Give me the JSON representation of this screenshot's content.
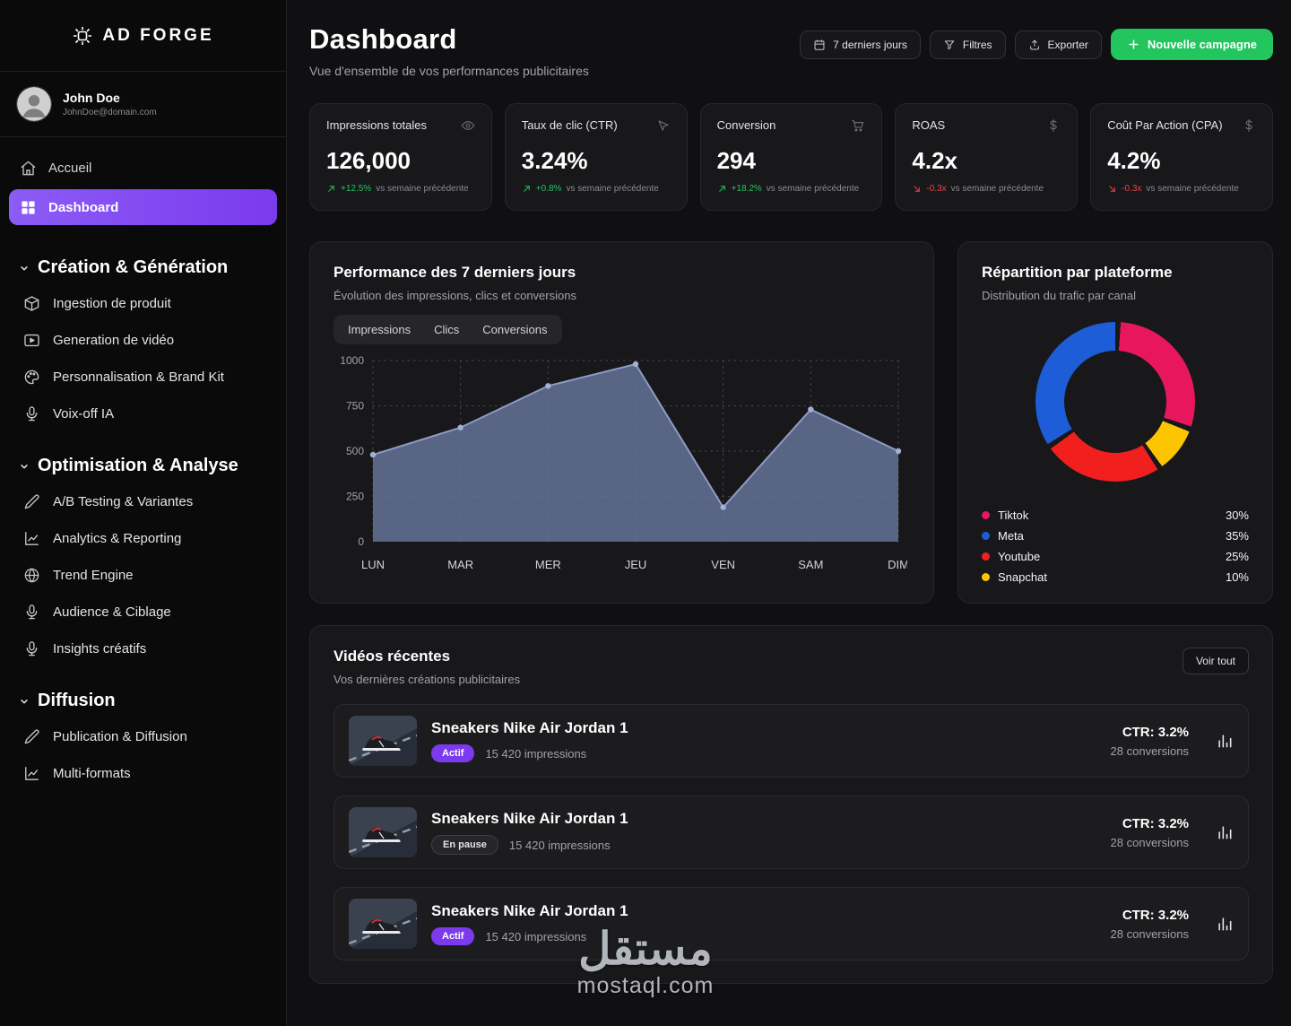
{
  "app": {
    "name": "AD FORGE"
  },
  "user": {
    "name": "John Doe",
    "email": "JohnDoe@domain.com"
  },
  "sidebar": {
    "nav": [
      {
        "label": "Accueil",
        "icon": "home",
        "active": false
      },
      {
        "label": "Dashboard",
        "icon": "grid",
        "active": true
      }
    ],
    "sections": [
      {
        "title": "Création & Génération",
        "items": [
          {
            "label": "Ingestion de produit",
            "icon": "package"
          },
          {
            "label": "Generation de vidéo",
            "icon": "video"
          },
          {
            "label": "Personnalisation & Brand Kit",
            "icon": "palette"
          },
          {
            "label": "Voix-off IA",
            "icon": "mic"
          }
        ]
      },
      {
        "title": "Optimisation & Analyse",
        "items": [
          {
            "label": "A/B Testing & Variantes",
            "icon": "pen"
          },
          {
            "label": "Analytics & Reporting",
            "icon": "chart"
          },
          {
            "label": "Trend Engine",
            "icon": "globe"
          },
          {
            "label": "Audience & Ciblage",
            "icon": "mic"
          },
          {
            "label": "Insights créatifs",
            "icon": "mic"
          }
        ]
      },
      {
        "title": "Diffusion",
        "items": [
          {
            "label": "Publication & Diffusion",
            "icon": "pen"
          },
          {
            "label": "Multi-formats",
            "icon": "chart"
          }
        ]
      }
    ]
  },
  "header": {
    "title": "Dashboard",
    "subtitle": "Vue d'ensemble de vos performances publicitaires",
    "date_range": "7 derniers jours",
    "filters_label": "Filtres",
    "export_label": "Exporter",
    "new_campaign_label": "Nouvelle campagne"
  },
  "kpis": [
    {
      "label": "Impressions totales",
      "icon": "eye",
      "value": "126,000",
      "delta": "+12.5%",
      "note": "vs semaine précédente",
      "trend": "up"
    },
    {
      "label": "Taux de clic (CTR)",
      "icon": "cursor",
      "value": "3.24%",
      "delta": "+0.8%",
      "note": "vs semaine précédente",
      "trend": "up"
    },
    {
      "label": "Conversion",
      "icon": "cart",
      "value": "294",
      "delta": "+18.2%",
      "note": "vs semaine précédente",
      "trend": "up"
    },
    {
      "label": "ROAS",
      "icon": "dollar",
      "value": "4.2x",
      "delta": "-0.3x",
      "note": "vs semaine précédente",
      "trend": "down"
    },
    {
      "label": "Coût Par Action (CPA)",
      "icon": "dollar",
      "value": "4.2%",
      "delta": "-0.3x",
      "note": "vs semaine précédente",
      "trend": "down"
    }
  ],
  "chart_data": [
    {
      "type": "area",
      "title": "Performance des 7 derniers jours",
      "subtitle": "Évolution des impressions, clics et conversions",
      "tabs": [
        "Impressions",
        "Clics",
        "Conversions"
      ],
      "categories": [
        "LUN",
        "MAR",
        "MER",
        "JEU",
        "VEN",
        "SAM",
        "DIM"
      ],
      "values": [
        480,
        630,
        860,
        980,
        190,
        730,
        500
      ],
      "ylim": [
        0,
        1000
      ],
      "yticks": [
        0,
        250,
        500,
        750,
        1000
      ],
      "grid": "dotted",
      "area_color": "#66769e",
      "line_color": "#8e9cc4",
      "legend_position": "none"
    },
    {
      "type": "donut",
      "title": "Répartition par plateforme",
      "subtitle": "Distribution du trafic par canal",
      "segments": [
        {
          "label": "Tiktok",
          "value": 30,
          "color": "#e8175d"
        },
        {
          "label": "Snapchat",
          "value": 10,
          "color": "#fdc500"
        },
        {
          "label": "Youtube",
          "value": 25,
          "color": "#f21f1f"
        },
        {
          "label": "Meta",
          "value": 35,
          "color": "#1d5dd8"
        }
      ],
      "legend_order": [
        "Tiktok",
        "Meta",
        "Youtube",
        "Snapchat"
      ]
    }
  ],
  "videos": {
    "title": "Vidéos récentes",
    "subtitle": "Vos dernières créations publicitaires",
    "see_all_label": "Voir tout",
    "items": [
      {
        "title": "Sneakers Nike Air Jordan 1",
        "status": "Actif",
        "status_kind": "actif",
        "impressions": "15 420 impressions",
        "ctr": "CTR: 3.2%",
        "conversions": "28 conversions"
      },
      {
        "title": "Sneakers Nike Air Jordan 1",
        "status": "En pause",
        "status_kind": "pause",
        "impressions": "15 420 impressions",
        "ctr": "CTR: 3.2%",
        "conversions": "28 conversions"
      },
      {
        "title": "Sneakers Nike Air Jordan 1",
        "status": "Actif",
        "status_kind": "actif",
        "impressions": "15 420 impressions",
        "ctr": "CTR: 3.2%",
        "conversions": "28 conversions"
      }
    ]
  },
  "colors": {
    "accent_purple": "#7c3aed",
    "success_green": "#22c55e",
    "danger_red": "#ef4444",
    "card_bg": "#18181b"
  },
  "watermark": {
    "line1": "مستقل",
    "line2": "mostaql.com"
  }
}
